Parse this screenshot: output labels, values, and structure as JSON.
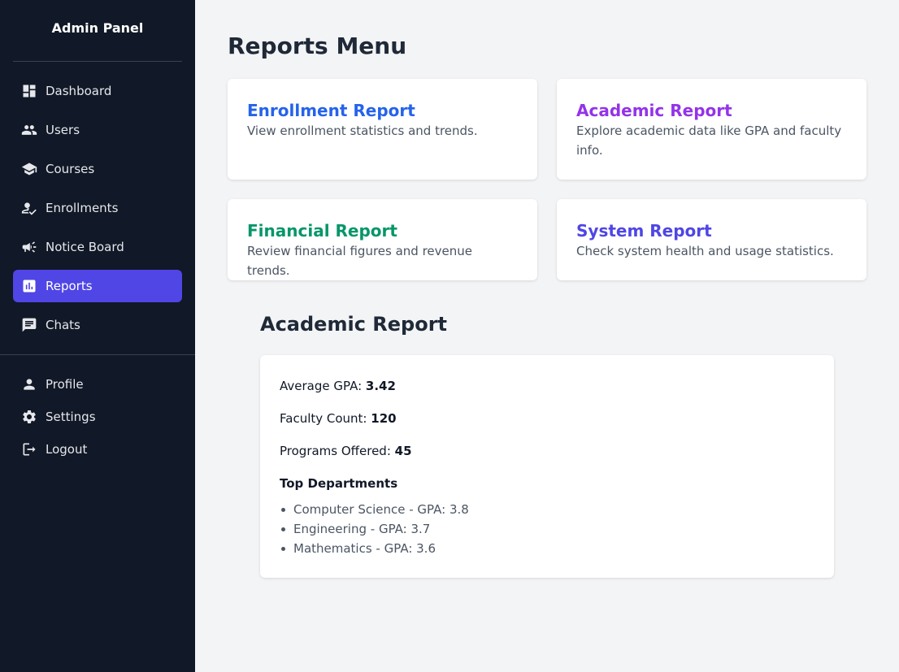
{
  "sidebar": {
    "brand": "Admin Panel",
    "nav": [
      {
        "label": "Dashboard",
        "icon": "dashboard-icon"
      },
      {
        "label": "Users",
        "icon": "users-icon"
      },
      {
        "label": "Courses",
        "icon": "graduation-cap-icon"
      },
      {
        "label": "Enrollments",
        "icon": "person-check-icon"
      },
      {
        "label": "Notice Board",
        "icon": "megaphone-icon"
      },
      {
        "label": "Reports",
        "icon": "bar-chart-icon",
        "active": true
      },
      {
        "label": "Chats",
        "icon": "chat-icon"
      }
    ],
    "account": [
      {
        "label": "Profile",
        "icon": "person-icon"
      },
      {
        "label": "Settings",
        "icon": "gear-icon"
      },
      {
        "label": "Logout",
        "icon": "logout-icon"
      }
    ]
  },
  "main": {
    "title": "Reports Menu",
    "cards": [
      {
        "title": "Enrollment Report",
        "desc": "View enrollment statistics and trends.",
        "color": "#2563eb"
      },
      {
        "title": "Academic Report",
        "desc": "Explore academic data like GPA and faculty info.",
        "color": "#9333ea"
      },
      {
        "title": "Financial Report",
        "desc": "Review financial figures and revenue trends.",
        "color": "#059669"
      },
      {
        "title": "System Report",
        "desc": "Check system health and usage statistics.",
        "color": "#4f46e5"
      }
    ],
    "report": {
      "title": "Academic Report",
      "stats": [
        {
          "label": "Average GPA:",
          "value": "3.42"
        },
        {
          "label": "Faculty Count:",
          "value": "120"
        },
        {
          "label": "Programs Offered:",
          "value": "45"
        }
      ],
      "departments_title": "Top Departments",
      "departments": [
        "Computer Science - GPA: 3.8",
        "Engineering - GPA: 3.7",
        "Mathematics - GPA: 3.6"
      ]
    }
  },
  "colors": {
    "sidebar_bg": "#111827",
    "active_bg": "#4f46e5",
    "page_bg": "#f3f4f6"
  }
}
